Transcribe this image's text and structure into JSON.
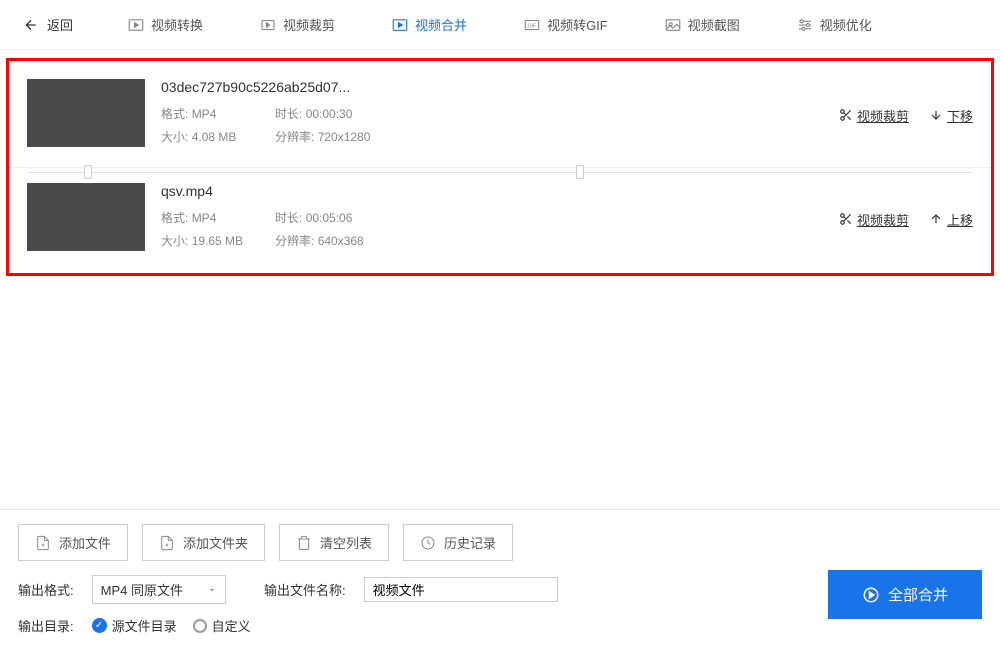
{
  "topbar": {
    "back": "返回",
    "tabs": [
      {
        "label": "视频转换"
      },
      {
        "label": "视频裁剪"
      },
      {
        "label": "视频合并",
        "active": true
      },
      {
        "label": "视频转GIF"
      },
      {
        "label": "视频截图"
      },
      {
        "label": "视频优化"
      }
    ]
  },
  "files": [
    {
      "name": "03dec727b90c5226ab25d07...",
      "format_label": "格式:",
      "format_val": "MP4",
      "duration_label": "时长:",
      "duration_val": "00:00:30",
      "size_label": "大小:",
      "size_val": "4.08 MB",
      "res_label": "分辨率:",
      "res_val": "720x1280",
      "crop_action": "视频裁剪",
      "move_action": "下移"
    },
    {
      "name": "qsv.mp4",
      "format_label": "格式:",
      "format_val": "MP4",
      "duration_label": "时长:",
      "duration_val": "00:05:06",
      "size_label": "大小:",
      "size_val": "19.65 MB",
      "res_label": "分辨率:",
      "res_val": "640x368",
      "crop_action": "视频裁剪",
      "move_action": "上移"
    }
  ],
  "buttons": {
    "add_file": "添加文件",
    "add_folder": "添加文件夹",
    "clear_list": "清空列表",
    "history": "历史记录"
  },
  "settings": {
    "format_label": "输出格式:",
    "format_value": "MP4 同原文件",
    "filename_label": "输出文件名称:",
    "filename_value": "视频文件",
    "outdir_label": "输出目录:",
    "radio_source": "源文件目录",
    "radio_custom": "自定义"
  },
  "merge_button": "全部合并"
}
